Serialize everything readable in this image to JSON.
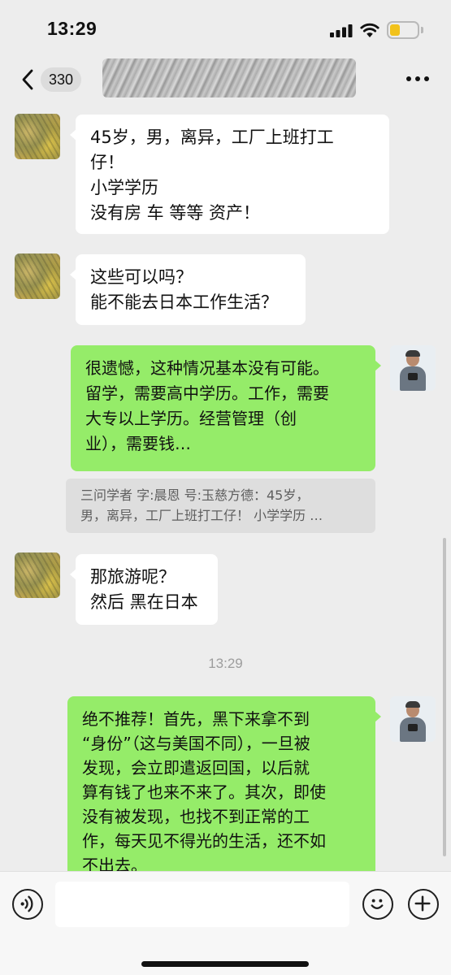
{
  "status_bar": {
    "time": "13:29",
    "battery_color": "#f2c21b"
  },
  "nav": {
    "unread_count": "330",
    "back_icon": "chevron-left-icon",
    "more_icon": "more-dots-icon"
  },
  "messages": [
    {
      "side": "left",
      "lines": [
        "45岁，男，离异，工厂上班打工",
        "仔！",
        "小学学历",
        "没有房  车 等等 资产！"
      ]
    },
    {
      "side": "left",
      "lines": [
        "这些可以吗？",
        "能不能去日本工作生活？"
      ]
    },
    {
      "side": "right",
      "lines": [
        "很遗憾，这种情况基本没有可能。",
        "留学，需要高中学历。工作，需要",
        "大专以上学历。经营管理（创",
        "业），需要钱…"
      ]
    },
    {
      "side": "quote",
      "lines": [
        "三问学者 字:晨恩 号:玉慈方德：45岁，",
        "男，离异，工厂上班打工仔！ 小学学历 …"
      ]
    },
    {
      "side": "left",
      "lines": [
        "那旅游呢？",
        "然后 黑在日本"
      ]
    },
    {
      "side": "right",
      "lines": [
        "绝不推荐！首先，黑下来拿不到",
        "“身份”（这与美国不同），一旦被",
        "发现，会立即遣返回国，以后就",
        "算有钱了也来不来了。其次，即使",
        "没有被发现，也找不到正常的工",
        "作，每天见不得光的生活，还不如",
        "不出去。"
      ]
    }
  ],
  "timestamp": "13:29",
  "input": {
    "value": "",
    "placeholder": ""
  },
  "colors": {
    "self_bubble": "#95ec69",
    "other_bubble": "#ffffff",
    "background": "#ededed"
  }
}
